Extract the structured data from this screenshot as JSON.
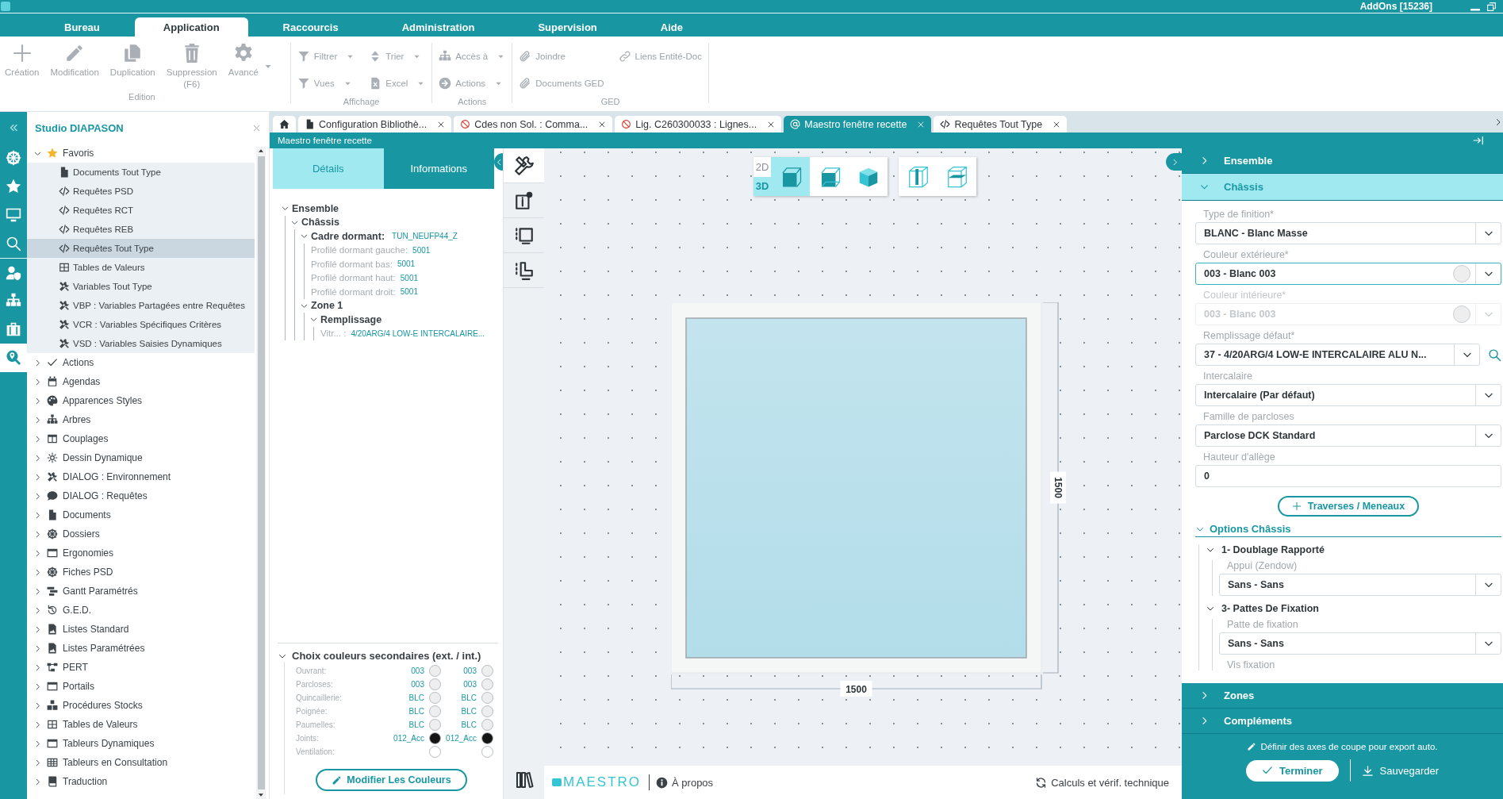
{
  "title_bar": {
    "title": "AddOns [15236]"
  },
  "menu_tabs": [
    {
      "label": "Bureau",
      "selected": false
    },
    {
      "label": "Application",
      "selected": true
    },
    {
      "label": "Raccourcis",
      "selected": false
    },
    {
      "label": "Administration",
      "selected": false
    },
    {
      "label": "Supervision",
      "selected": false
    },
    {
      "label": "Aide",
      "selected": false
    }
  ],
  "ribbon": {
    "groups": [
      {
        "label": "Edition",
        "items": [
          {
            "kind": "large",
            "label": "Création"
          },
          {
            "kind": "large",
            "label": "Modification"
          },
          {
            "kind": "large",
            "label": "Duplication"
          },
          {
            "kind": "large",
            "label": "Suppression (F6)"
          },
          {
            "kind": "large-menu",
            "label": "Avancé"
          }
        ]
      },
      {
        "label": "Affichage",
        "items": [
          {
            "kind": "small-menu",
            "label": "Filtrer"
          },
          {
            "kind": "small-menu",
            "label": "Trier"
          },
          {
            "kind": "small-menu",
            "label": "Vues"
          },
          {
            "kind": "small-menu",
            "label": "Excel"
          }
        ]
      },
      {
        "label": "Actions",
        "items": [
          {
            "kind": "small-menu",
            "label": "Accès à"
          },
          {
            "kind": "small-menu",
            "label": "Actions"
          }
        ]
      },
      {
        "label": "GED",
        "items": [
          {
            "kind": "small",
            "label": "Joindre"
          },
          {
            "kind": "small",
            "label": "Liens Entité-Doc"
          },
          {
            "kind": "small",
            "label": "Documents GED"
          }
        ]
      }
    ]
  },
  "icon_rail": {
    "items": [
      {
        "selected": false
      },
      {
        "selected": false
      },
      {
        "selected": false
      },
      {
        "selected": false
      },
      {
        "selected": false
      },
      {
        "selected": false
      },
      {
        "selected": false
      },
      {
        "selected": true
      }
    ]
  },
  "sidebar": {
    "title": "Studio DIAPASON",
    "tree": [
      {
        "label": "Favoris",
        "expanded": true,
        "selected": false,
        "children": [
          {
            "label": "Documents Tout Type",
            "selected": false
          },
          {
            "label": "Requêtes PSD",
            "selected": false
          },
          {
            "label": "Requêtes RCT",
            "selected": false
          },
          {
            "label": "Requêtes REB",
            "selected": false
          },
          {
            "label": "Requêtes Tout Type",
            "selected": true
          },
          {
            "label": "Tables de Valeurs",
            "selected": false
          },
          {
            "label": "Variables Tout Type",
            "selected": false
          },
          {
            "label": "VBP : Variables Partagées entre Requêtes",
            "selected": false
          },
          {
            "label": "VCR : Variables Spécifiques Critères",
            "selected": false
          },
          {
            "label": "VSD : Variables Saisies Dynamiques",
            "selected": false
          }
        ]
      },
      {
        "label": "Actions",
        "expanded": false,
        "selected": false
      },
      {
        "label": "Agendas",
        "expanded": false,
        "selected": false
      },
      {
        "label": "Apparences Styles",
        "expanded": false,
        "selected": false
      },
      {
        "label": "Arbres",
        "expanded": false,
        "selected": false
      },
      {
        "label": "Couplages",
        "expanded": false,
        "selected": false
      },
      {
        "label": "Dessin Dynamique",
        "expanded": false,
        "selected": false
      },
      {
        "label": "DIALOG : Environnement",
        "expanded": false,
        "selected": false
      },
      {
        "label": "DIALOG : Requêtes",
        "expanded": false,
        "selected": false
      },
      {
        "label": "Documents",
        "expanded": false,
        "selected": false
      },
      {
        "label": "Dossiers",
        "expanded": false,
        "selected": false
      },
      {
        "label": "Ergonomies",
        "expanded": false,
        "selected": false
      },
      {
        "label": "Fiches PSD",
        "expanded": false,
        "selected": false
      },
      {
        "label": "Gantt Paramétrés",
        "expanded": false,
        "selected": false
      },
      {
        "label": "G.E.D.",
        "expanded": false,
        "selected": false
      },
      {
        "label": "Listes Standard",
        "expanded": false,
        "selected": false
      },
      {
        "label": "Listes Paramétrées",
        "expanded": false,
        "selected": false
      },
      {
        "label": "PERT",
        "expanded": false,
        "selected": false
      },
      {
        "label": "Portails",
        "expanded": false,
        "selected": false
      },
      {
        "label": "Procédures Stocks",
        "expanded": false,
        "selected": false
      },
      {
        "label": "Tables de Valeurs",
        "expanded": false,
        "selected": false
      },
      {
        "label": "Tableurs Dynamiques",
        "expanded": false,
        "selected": false
      },
      {
        "label": "Tableurs en Consultation",
        "expanded": false,
        "selected": false
      },
      {
        "label": "Traduction",
        "expanded": false,
        "selected": false
      }
    ]
  },
  "document_tabs": [
    {
      "kind": "home",
      "selected": false
    },
    {
      "kind": "document",
      "label": "Configuration  Bibliothè...",
      "selected": false
    },
    {
      "kind": "blocked",
      "label": "Cdes non Sol. : Comma...",
      "selected": false
    },
    {
      "kind": "blocked",
      "label": "Lig. C260300033 : Lignes...",
      "selected": false
    },
    {
      "kind": "maestro",
      "label": "Maestro fenêtre recette",
      "selected": true
    },
    {
      "kind": "code",
      "label": "Requêtes Tout Type",
      "selected": false
    }
  ],
  "panel_title": "Maestro fenêtre recette",
  "details": {
    "tabs": [
      {
        "label": "Détails",
        "selected": true
      },
      {
        "label": "Informations",
        "selected": false
      }
    ],
    "tree": [
      {
        "label": "Ensemble",
        "expanded": true,
        "children": [
          {
            "label": "Châssis",
            "expanded": true,
            "children": [
              {
                "label": "Cadre dormant:",
                "value": "TUN_NEUFP44_Z",
                "expanded": true,
                "children": [
                  {
                    "label": "Profilé dormant gauche:",
                    "value": "5001"
                  },
                  {
                    "label": "Profilé dormant bas:",
                    "value": "5001"
                  },
                  {
                    "label": "Profilé dormant haut:",
                    "value": "5001"
                  },
                  {
                    "label": "Profilé dormant droit:",
                    "value": "5001"
                  }
                ]
              },
              {
                "label": "Zone 1",
                "expanded": true,
                "children": [
                  {
                    "label": "Remplissage",
                    "expanded": true,
                    "children": [
                      {
                        "label": "Vitr... :",
                        "value": "4/20ARG/4 LOW-E INTERCALAIRE..."
                      }
                    ]
                  }
                ]
              }
            ]
          }
        ]
      }
    ],
    "secondary_colors": {
      "title": "Choix couleurs secondaires (ext. / int.)",
      "expanded": true,
      "rows": [
        {
          "label": "Ouvrant:",
          "ext": {
            "code": "003",
            "color": "#eeeeee"
          },
          "int": {
            "code": "003",
            "color": "#eeeeee"
          }
        },
        {
          "label": "Parcloses:",
          "ext": {
            "code": "003",
            "color": "#eeeeee"
          },
          "int": {
            "code": "003",
            "color": "#eeeeee"
          }
        },
        {
          "label": "Quincaillerie:",
          "ext": {
            "code": "BLC",
            "color": "#eeeeee"
          },
          "int": {
            "code": "BLC",
            "color": "#eeeeee"
          }
        },
        {
          "label": "Poignée:",
          "ext": {
            "code": "BLC",
            "color": "#eeeeee"
          },
          "int": {
            "code": "BLC",
            "color": "#eeeeee"
          }
        },
        {
          "label": "Paumelles:",
          "ext": {
            "code": "BLC",
            "color": "#eeeeee"
          },
          "int": {
            "code": "BLC",
            "color": "#eeeeee"
          }
        },
        {
          "label": "Joints:",
          "ext": {
            "code": "012_Acc",
            "color": "#151515"
          },
          "int": {
            "code": "012_Acc",
            "color": "#151515"
          }
        },
        {
          "label": "Ventilation:",
          "ext": {
            "color": "#ffffff"
          },
          "int": {
            "color": "#ffffff"
          }
        }
      ],
      "button": "Modifier Les Couleurs"
    }
  },
  "tool_column": {
    "items": [
      {
        "selected": true
      },
      {
        "selected": false
      },
      {
        "selected": false
      },
      {
        "selected": false
      }
    ]
  },
  "canvas": {
    "view_modes": [
      {
        "label": "2D",
        "selected": false
      },
      {
        "label": "3D",
        "selected": true
      }
    ],
    "view_buttons": [
      {
        "selected": true
      },
      {
        "selected": false
      },
      {
        "selected": false
      }
    ],
    "width_dimension": "1500",
    "height_dimension": "1500",
    "footer": {
      "logo": "MAESTRO",
      "about": "À propos",
      "check": "Calculs et vérif. technique"
    }
  },
  "properties": {
    "sections": [
      {
        "title": "Ensemble",
        "expanded": false
      },
      {
        "title": "Châssis",
        "expanded": true,
        "fields": [
          {
            "kind": "select",
            "label": "Type de finition*",
            "value": "BLANC - Blanc Masse",
            "disabled": false,
            "focused": false
          },
          {
            "kind": "color-select",
            "label": "Couleur extérieure*",
            "value": "003 - Blanc 003",
            "disabled": false,
            "focused": true
          },
          {
            "kind": "color-select",
            "label": "Couleur intérieure*",
            "value": "003 - Blanc 003",
            "disabled": true,
            "focused": false
          },
          {
            "kind": "select-search",
            "label": "Remplissage défaut*",
            "value": "37 - 4/20ARG/4 LOW-E INTERCALAIRE ALU N...",
            "disabled": false,
            "focused": false
          },
          {
            "kind": "select",
            "label": "Intercalaire",
            "value": "Intercalaire (Par défaut)",
            "disabled": false,
            "focused": false
          },
          {
            "kind": "select",
            "label": "Famille de parcloses",
            "value": "Parclose DCK Standard",
            "disabled": false,
            "focused": false
          },
          {
            "kind": "text",
            "label": "Hauteur d'allège",
            "value": "0",
            "disabled": false,
            "focused": false
          }
        ],
        "button": "Traverses / Meneaux",
        "options": {
          "title": "Options Châssis",
          "expanded": true,
          "groups": [
            {
              "title": "1- Doublage Rapporté",
              "expanded": true,
              "fields": [
                {
                  "kind": "select",
                  "label": "Appui (Zendow)",
                  "value": "Sans - Sans"
                }
              ]
            },
            {
              "title": "3- Pattes De Fixation",
              "expanded": true,
              "fields": [
                {
                  "kind": "select",
                  "label": "Patte de fixation",
                  "value": "Sans - Sans"
                },
                {
                  "kind": "label",
                  "label": "Vis fixation"
                }
              ]
            }
          ]
        }
      },
      {
        "title": "Zones",
        "expanded": false
      },
      {
        "title": "Compléments",
        "expanded": false
      }
    ],
    "footer": {
      "link": "Définir des axes de coupe pour export auto.",
      "buttons": [
        {
          "kind": "primary",
          "label": "Terminer"
        },
        {
          "kind": "plain",
          "label": "Sauvegarder"
        }
      ]
    }
  }
}
